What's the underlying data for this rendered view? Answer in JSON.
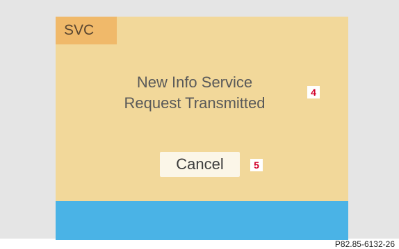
{
  "header": {
    "mode_label": "SVC"
  },
  "message": {
    "line1": "New Info Service",
    "line2": "Request Transmitted"
  },
  "actions": {
    "cancel_label": "Cancel"
  },
  "callouts": {
    "message_marker": "4",
    "cancel_marker": "5"
  },
  "figure": {
    "reference": "P82.85-6132-26"
  },
  "colors": {
    "screen_background": "#f2d89a",
    "tab_background": "#f0b96a",
    "bottom_bar": "#4ab3e6",
    "callout_text": "#d1002a"
  }
}
